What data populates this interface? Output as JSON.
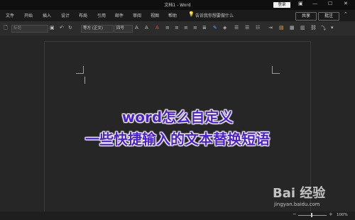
{
  "window": {
    "title": "文档1 - Word",
    "login_label": "登录",
    "restore_icon": "restore-icon",
    "minimize_icon": "minimize-icon",
    "maximize_icon": "maximize-icon",
    "close_icon": "close-icon"
  },
  "ribbon": {
    "tabs": [
      "文件",
      "开始",
      "插入",
      "设计",
      "布局",
      "引用",
      "邮件",
      "审阅",
      "视图",
      "帮助"
    ],
    "search_text": "告诉我你想要做什么",
    "share_label": "共享",
    "comment_label": "批注"
  },
  "toolbar": {
    "style_box": "标题",
    "font_name": "等方 (正文)",
    "font_size": "四号"
  },
  "document": {
    "overlay_line1": "word怎么自定义",
    "overlay_line2": "一些快捷输入的文本替换短语"
  },
  "status": {
    "zoom_level": "100%"
  },
  "watermark": {
    "logo": "Bai 经验",
    "url": "jingyan.baidu.com"
  }
}
